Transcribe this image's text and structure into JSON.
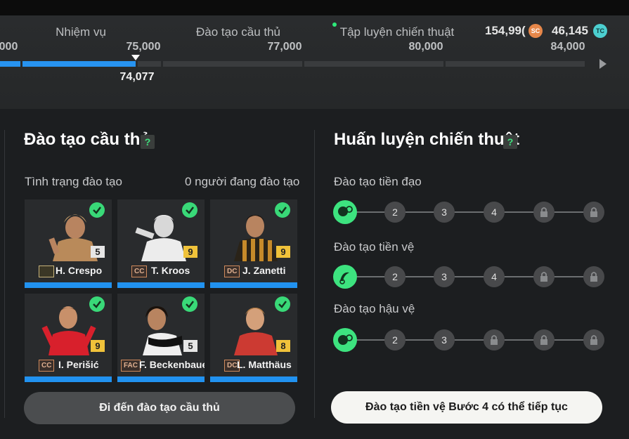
{
  "tabs": [
    {
      "label": "Nhiệm vụ"
    },
    {
      "label": "Đào tạo cầu thủ"
    },
    {
      "label": "Tập luyện chiến thuật"
    }
  ],
  "currency": {
    "sc_value": "154,99(",
    "sc_icon": "SC",
    "tc_value": "46,145",
    "tc_icon": "TC"
  },
  "progress": {
    "milestones": [
      "000",
      "75,000",
      "77,000",
      "80,000",
      "84,000"
    ],
    "current": "74,077"
  },
  "player_training": {
    "title": "Đào tạo cầu thủ",
    "help": "?",
    "status_label": "Tình trạng đào tạo",
    "status_value": "0 người đang đào tạo",
    "players": [
      {
        "name": "H. Crespo",
        "rating": "5",
        "position": "",
        "rating_style": "white"
      },
      {
        "name": "T. Kroos",
        "rating": "9",
        "position": "CC",
        "rating_style": "gold"
      },
      {
        "name": "J. Zanetti",
        "rating": "9",
        "position": "DC",
        "rating_style": "gold"
      },
      {
        "name": "I. Perišić",
        "rating": "9",
        "position": "CC",
        "rating_style": "gold"
      },
      {
        "name": "F. Beckenbaue",
        "rating": "5",
        "position": "FAC",
        "rating_style": "white"
      },
      {
        "name": "L. Matthäus",
        "rating": "8",
        "position": "DC",
        "rating_style": "gold"
      }
    ],
    "button": "Đi đến đào tạo cầu thủ"
  },
  "tactical_training": {
    "title": "Huấn luyện chiến thuật",
    "help": "?",
    "rows": [
      {
        "label": "Đào tạo tiền đạo",
        "steps": [
          "2",
          "3",
          "4"
        ]
      },
      {
        "label": "Đào tạo tiền vệ",
        "steps": [
          "2",
          "3",
          "4"
        ]
      },
      {
        "label": "Đào tạo hậu vệ",
        "steps": [
          "2",
          "3"
        ]
      }
    ],
    "button": "Đào tạo tiền vệ Bước 4 có thể tiếp tục"
  },
  "colors": {
    "accent_blue": "#2793f0",
    "accent_green": "#3de37f",
    "gold": "#f0c23a"
  }
}
